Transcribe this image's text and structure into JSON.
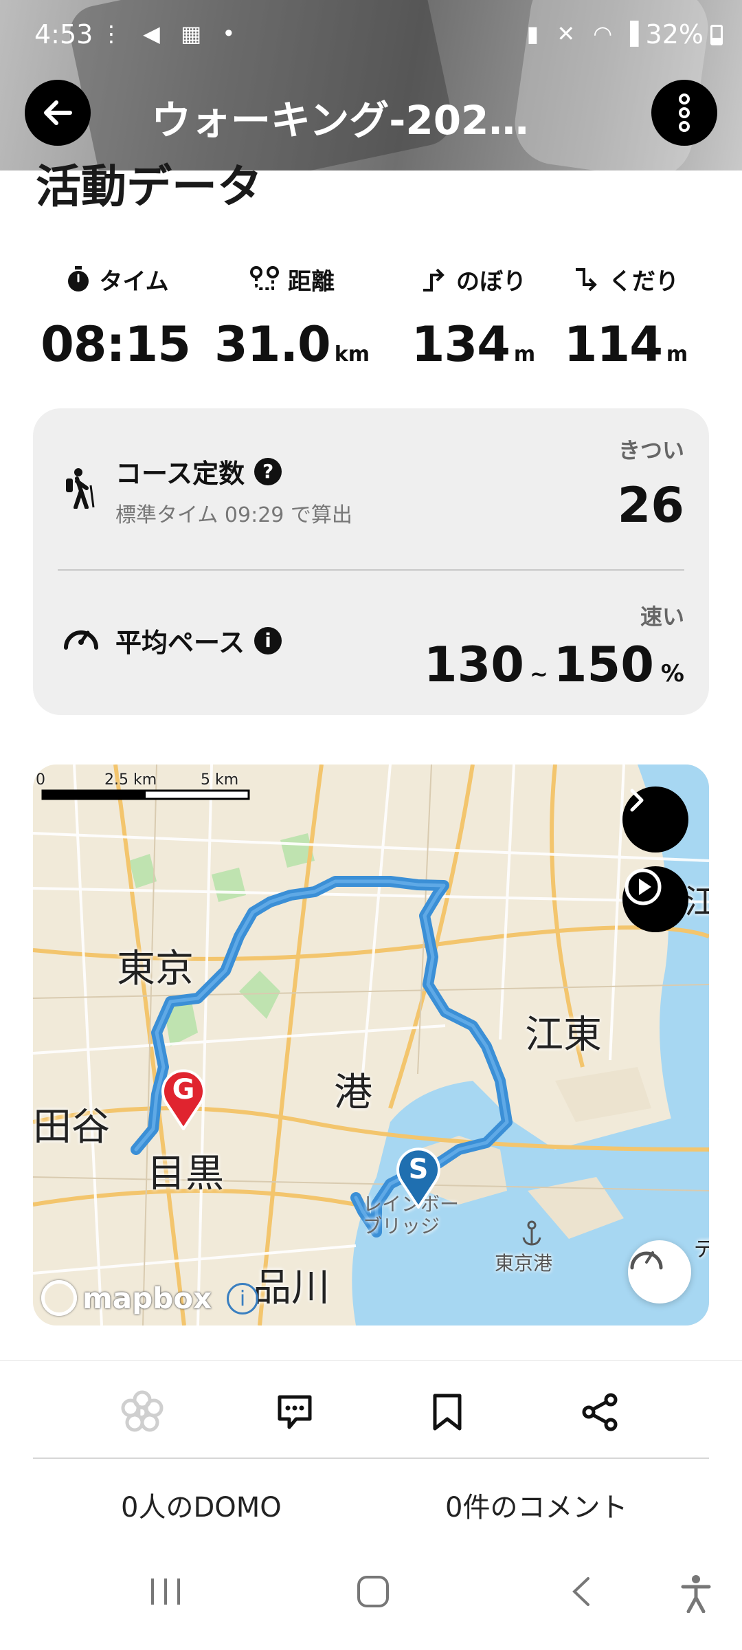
{
  "status_bar": {
    "time": "4:53",
    "left_icons": "⋮ ◀ ▦ •",
    "right_icons": "▮ ✕ ◠ ▌",
    "battery": "32%"
  },
  "header": {
    "title": "ウォーキング-202…"
  },
  "section": {
    "title": "活動データ"
  },
  "stats": [
    {
      "label": "タイム",
      "value": "08:15",
      "unit": "",
      "icon": "stopwatch-icon"
    },
    {
      "label": "距離",
      "value": "31.0",
      "unit": "km",
      "icon": "route-icon"
    },
    {
      "label": "のぼり",
      "value": "134",
      "unit": "m",
      "icon": "ascent-icon"
    },
    {
      "label": "くだり",
      "value": "114",
      "unit": "m",
      "icon": "descent-icon"
    }
  ],
  "course": {
    "title": "コース定数",
    "subtitle": "標準タイム 09:29 で算出",
    "level": "きつい",
    "value": "26",
    "help": "?"
  },
  "pace": {
    "title": "平均ペース",
    "info": "i",
    "level": "速い",
    "min": "130",
    "tilde": "~",
    "max": "150",
    "unit": "%"
  },
  "map": {
    "scale_labels": [
      "0",
      "2.5 km",
      "5 km"
    ],
    "labels": {
      "tokyo": "東京",
      "koto": "江東",
      "minato": "港",
      "meguro": "目黒",
      "setagaya": "田谷",
      "shinagawa": "品川",
      "rainbow_bridge": "レインボー\nブリッジ",
      "tokyo_port": "東京港",
      "edge_right": "江",
      "edge_right2": "デ"
    },
    "markers": {
      "start": "S",
      "goal": "G"
    },
    "attribution": "mapbox",
    "info": "i"
  },
  "actions": {
    "domo_count": "0人のDOMO",
    "comment_count": "0件のコメント"
  },
  "colors": {
    "route": "#3b8fd6",
    "goal": "#e0242f",
    "start": "#1f6fb0",
    "water": "#a7d7f2",
    "land": "#f2ebdc"
  }
}
